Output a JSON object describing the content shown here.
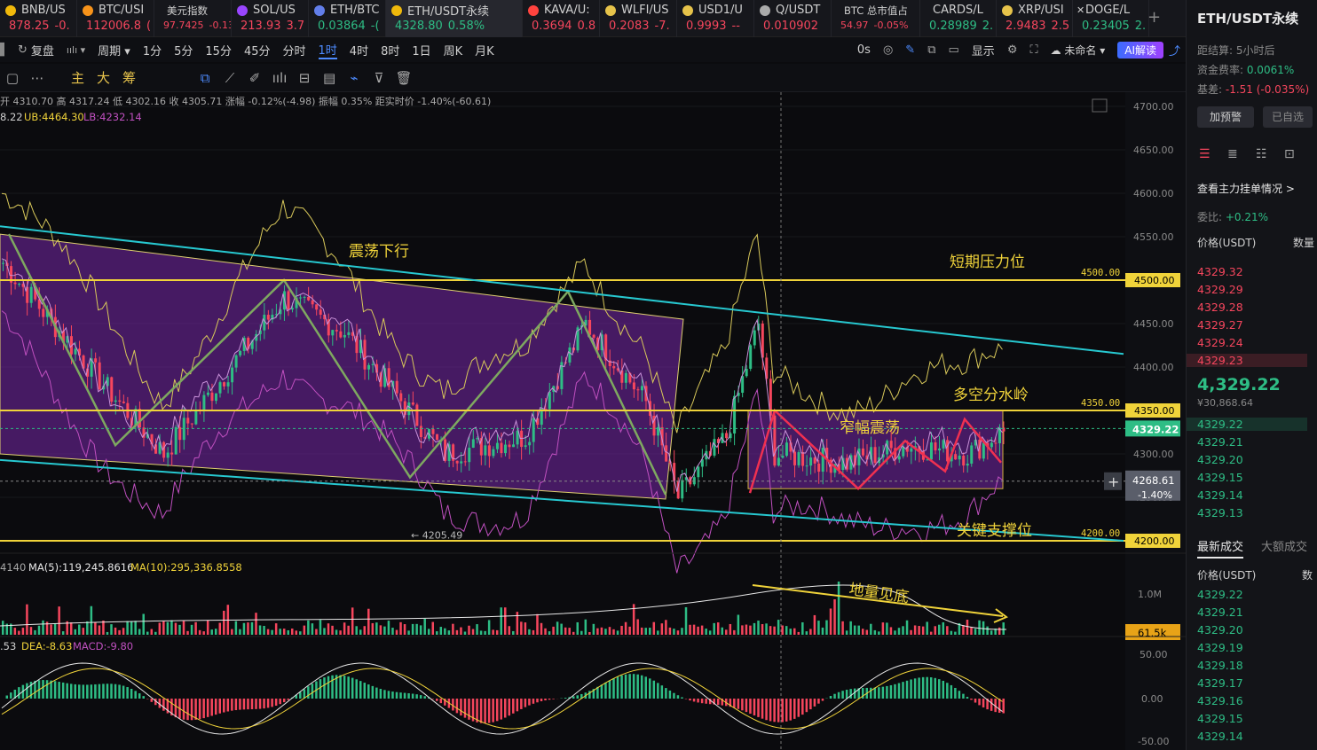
{
  "tickers": [
    {
      "name": "BNB/US",
      "price": "878.25",
      "chg": "-0.",
      "dir": "dn",
      "dot": "#f0b90b",
      "w": 87
    },
    {
      "name": "BTC/USI",
      "price": "112006.8",
      "chg": "(",
      "dir": "dn",
      "dot": "#f7931a",
      "w": 87
    },
    {
      "name": "美元指数",
      "price": "97.7425",
      "chg": "-0.13",
      "dir": "dn",
      "dot": "",
      "w": 87,
      "small": true
    },
    {
      "name": "SOL/US",
      "price": "213.93",
      "chg": "3.7",
      "dir": "dn",
      "dot": "#9945ff",
      "w": 87
    },
    {
      "name": "ETH/BTC",
      "price": "0.03864",
      "chg": "-(",
      "dir": "up",
      "dot": "#627eea",
      "w": 87
    },
    {
      "name": "ETH/USDT永续",
      "price": "4328.80",
      "chg": "0.58%",
      "dir": "up",
      "dot": "#f0b90b",
      "w": 154,
      "active": true
    },
    {
      "name": "KAVA/U:",
      "price": "0.3694",
      "chg": "0.8",
      "dir": "dn",
      "dot": "#ff433e",
      "w": 87
    },
    {
      "name": "WLFI/US",
      "price": "0.2083",
      "chg": "-7.",
      "dir": "dn",
      "dot": "#e6c34a",
      "w": 87
    },
    {
      "name": "USD1/U",
      "price": "0.9993",
      "chg": "--",
      "dir": "dn",
      "dot": "#e6c34a",
      "w": 87
    },
    {
      "name": "Q/USDT",
      "price": "0.010902",
      "chg": "",
      "dir": "dn",
      "dot": "#aaaaaa",
      "w": 87
    },
    {
      "name": "BTC 总市值占",
      "price": "54.97",
      "chg": "-0.05%",
      "dir": "dn",
      "dot": "",
      "w": 100,
      "small": true
    },
    {
      "name": "CARDS/L",
      "price": "0.28989",
      "chg": "2.",
      "dir": "up",
      "dot": "",
      "w": 86
    },
    {
      "name": "XRP/USI",
      "price": "2.9483",
      "chg": "2.5",
      "dir": "dn",
      "dot": "#e6c34a",
      "w": 86
    },
    {
      "name": "DOGE/L",
      "price": "0.23405",
      "chg": "2.",
      "dir": "up",
      "dot": "",
      "w": 86,
      "x": true
    }
  ],
  "toolbar1": {
    "items": [
      "复盘",
      "周期",
      "1分",
      "5分",
      "15分",
      "45分",
      "分时",
      "1时",
      "4时",
      "8时",
      "1日",
      "周K",
      "月K"
    ],
    "active": "1时",
    "right": [
      "0s",
      "显示",
      "未命名",
      "AI解读"
    ]
  },
  "toolbar2": {
    "indicators": [
      "主",
      "大",
      "筹"
    ]
  },
  "ohlc": {
    "open": "开 4310.70",
    "high": "高 4317.24",
    "low": "低 4302.16",
    "close": "收 4305.71",
    "chg": "涨幅 -0.12%(-4.98)",
    "amp": "振幅 0.35%",
    "dist": "距实时价 -1.40%(-60.61)"
  },
  "boll": {
    "mid": "8.22",
    "ub": "UB:4464.30",
    "lb": "LB:4232.14"
  },
  "vol": {
    "v": "4140",
    "ma5": "MA(5):119,245.8616",
    "ma10": "MA(10):295,336.8558"
  },
  "macd": {
    "dif": ".53",
    "dea": "DEA:-8.63",
    "macd": "MACD:-9.80"
  },
  "price_axis": [
    "4700.00",
    "4650.00",
    "4600.00",
    "4550.00",
    "4500.00",
    "4450.00",
    "4400.00",
    "4350.00",
    "4300.00",
    "4250.00",
    "4200.00"
  ],
  "price_tags": {
    "p4500": "4500.00",
    "p4350": "4350.00",
    "p4200": "4200.00",
    "last": "4329.22",
    "cross": "4268.61",
    "cross_pct": "-1.40%"
  },
  "low_label": "← 4205.49",
  "annotations": {
    "zhendang": "震荡下行",
    "yali": "短期压力位",
    "fenshuiling": "多空分水岭",
    "zhaifu": "窄幅震荡",
    "zhicheng": "关键支撑位",
    "diliang": "地量见底"
  },
  "vol_axis": {
    "top": "1.0M",
    "tag": "61.5k"
  },
  "macd_axis": [
    "50.00",
    "0.00",
    "-50.00"
  ],
  "right_panel": {
    "title": "ETH/USDT永续",
    "settle": "距结算: 5小时后",
    "funding_label": "资金费率:",
    "funding": "0.0061%",
    "basis_label": "基差:",
    "basis": "-1.51 (-0.035%)",
    "btn_alert": "加预警",
    "btn_fav": "已自选",
    "main_order": "查看主力挂单情况 >",
    "ratio_label": "委比:",
    "ratio": "+0.21%",
    "col_price": "价格(USDT)",
    "col_qty": "数量",
    "asks": [
      "4329.32",
      "4329.29",
      "4329.28",
      "4329.27",
      "4329.24",
      "4329.23"
    ],
    "mid_price": "4,329.22",
    "mid_cny": "¥30,868.64",
    "bids": [
      "4329.22",
      "4329.21",
      "4329.20",
      "4329.15",
      "4329.14",
      "4329.13"
    ],
    "tab_latest": "最新成交",
    "tab_big": "大额成交",
    "trades_col": "价格(USDT)",
    "trades_qty": "数",
    "trades": [
      "4329.22",
      "4329.21",
      "4329.20",
      "4329.19",
      "4329.18",
      "4329.17",
      "4329.16",
      "4329.15",
      "4329.14"
    ]
  },
  "colors": {
    "up": "#2ebd85",
    "down": "#f6465d",
    "accent": "#1e6fff",
    "gold": "#f0d33a"
  }
}
